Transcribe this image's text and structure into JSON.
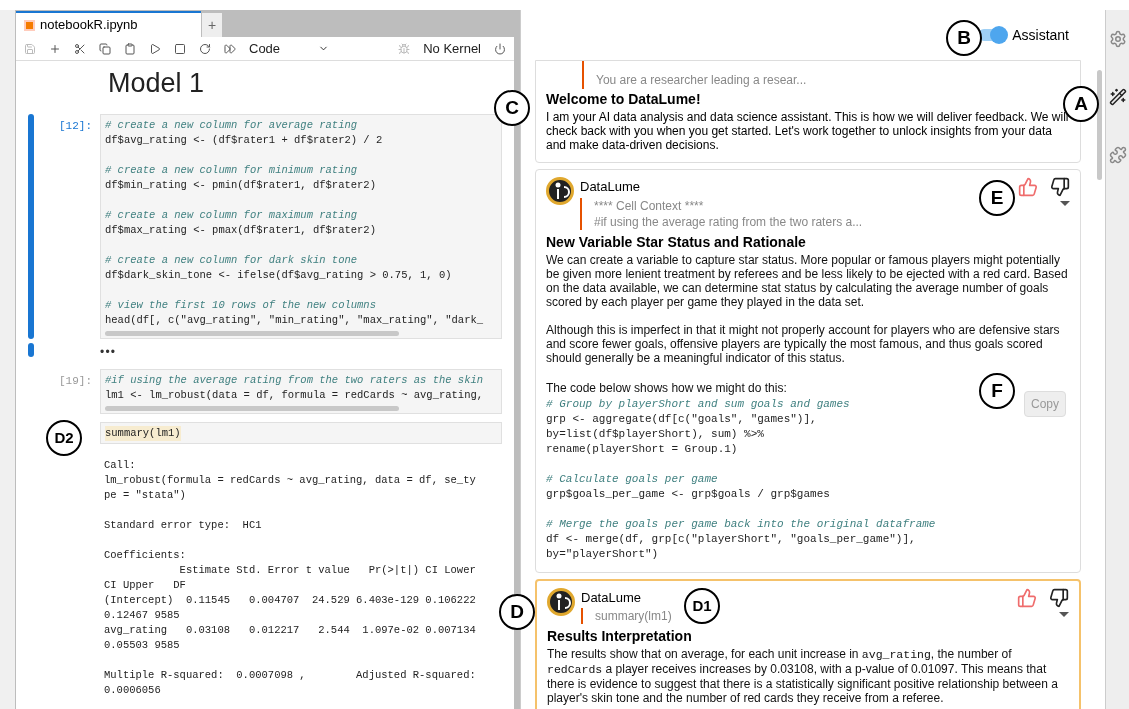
{
  "notebook": {
    "tab": {
      "title": "notebookR.ipynb",
      "selected": true
    },
    "new_tab": "+",
    "cell_type": "Code",
    "kernel": "No Kernel",
    "heading": "Model 1",
    "cells": [
      {
        "kind": "code",
        "prompt": "[12]:",
        "active": true,
        "lines": [
          {
            "kind": "comment",
            "text": "# create a new column for average rating"
          },
          {
            "kind": "code",
            "text": "df$avg_rating <- (df$rater1 + df$rater2) / 2"
          },
          {
            "kind": "blank"
          },
          {
            "kind": "comment",
            "text": "# create a new column for minimum rating"
          },
          {
            "kind": "code",
            "text": "df$min_rating <- pmin(df$rater1, df$rater2)"
          },
          {
            "kind": "blank"
          },
          {
            "kind": "comment",
            "text": "# create a new column for maximum rating"
          },
          {
            "kind": "code",
            "text": "df$max_rating <- pmax(df$rater1, df$rater2)"
          },
          {
            "kind": "blank"
          },
          {
            "kind": "comment",
            "text": "# create a new column for dark skin tone"
          },
          {
            "kind": "code",
            "text": "df$dark_skin_tone <- ifelse(df$avg_rating > 0.75, 1, 0)"
          },
          {
            "kind": "blank"
          },
          {
            "kind": "comment",
            "text": "# view the first 10 rows of the new columns"
          },
          {
            "kind": "code",
            "text": "head(df[, c(\"avg_rating\", \"min_rating\", \"max_rating\", \"dark_"
          }
        ]
      },
      {
        "kind": "collapsed",
        "active": true,
        "text": "•••"
      },
      {
        "kind": "code",
        "prompt": "[19]:",
        "active": false,
        "lines": [
          {
            "kind": "comment",
            "text": "#if using the average rating from the two raters as the skin"
          },
          {
            "kind": "code",
            "text": "lm1 <- lm_robust(data = df, formula = redCards ~ avg_rating,"
          }
        ]
      },
      {
        "kind": "highlight",
        "active": false,
        "lines": [
          {
            "kind": "code",
            "text": "summary(lm1)"
          }
        ]
      },
      {
        "kind": "output",
        "active": false,
        "lines": [
          {
            "kind": "code",
            "text": "Call:"
          },
          {
            "kind": "code",
            "text": "lm_robust(formula = redCards ~ avg_rating, data = df, se_ty"
          },
          {
            "kind": "code",
            "text": "pe = \"stata\")"
          },
          {
            "kind": "blank"
          },
          {
            "kind": "code",
            "text": "Standard error type:  HC1"
          },
          {
            "kind": "blank"
          },
          {
            "kind": "code",
            "text": "Coefficients:"
          },
          {
            "kind": "code",
            "text": "            Estimate Std. Error t value   Pr(>|t|) CI Lower"
          },
          {
            "kind": "code",
            "text": "CI Upper   DF"
          },
          {
            "kind": "code",
            "text": "(Intercept)  0.11545   0.004707  24.529 6.403e-129 0.106222"
          },
          {
            "kind": "code",
            "text": "0.12467 9585"
          },
          {
            "kind": "code",
            "text": "avg_rating   0.03108   0.012217   2.544  1.097e-02 0.007134"
          },
          {
            "kind": "code",
            "text": "0.05503 9585"
          },
          {
            "kind": "blank"
          },
          {
            "kind": "code",
            "text": "Multiple R-squared:  0.0007098 ,        Adjusted R-squared:"
          },
          {
            "kind": "code",
            "text": "0.0006056"
          }
        ]
      }
    ]
  },
  "assistant": {
    "toggle": {
      "label": "Assistant",
      "on": true
    },
    "welcome": {
      "context": "You are a researcher leading a resear...",
      "title": "Welcome to DataLume!",
      "body": "I am your AI data analysis and data science assistant. This is how we will deliver feedback. We will check back with you when you get started. Let's work together to unlock insights from your data and make data-driven decisions."
    },
    "messages": [
      {
        "sender": "DataLume",
        "highlighted": false,
        "context": [
          "**** Cell Context ****",
          "#if using the average rating from the two raters a..."
        ],
        "title": "New Variable Star Status and Rationale",
        "paragraphs": [
          [
            {
              "kind": "text",
              "text": "We can create a variable to capture star status. More popular or famous players might potentially be given more lenient treatment by referees and be less likely to be ejected with a red card. Based on the data available, we can determine stat status by calculating the average number of goals scored by each player per game they played in the data set."
            }
          ],
          [
            {
              "kind": "text",
              "text": "Although this is imperfect in that it might not properly account for players who are defensive stars and score fewer goals, offensive players are typically the most famous, and thus goals scored should generally be a meaningful indicator of this status."
            }
          ]
        ],
        "code_intro": "The code below shows how we might do this:",
        "copy": "Copy",
        "code": [
          {
            "kind": "comment",
            "text": "# Group by playerShort and sum goals and games"
          },
          {
            "kind": "code",
            "text": "grp <- aggregate(df[c(\"goals\", \"games\")],"
          },
          {
            "kind": "code",
            "text": "by=list(df$playerShort), sum) %>%"
          },
          {
            "kind": "code",
            "text": "rename(playerShort = Group.1)"
          },
          {
            "kind": "blank"
          },
          {
            "kind": "comment",
            "text": "# Calculate goals per game"
          },
          {
            "kind": "code",
            "text": "grp$goals_per_game <- grp$goals / grp$games"
          },
          {
            "kind": "blank"
          },
          {
            "kind": "comment",
            "text": "# Merge the goals per game back into the original dataframe"
          },
          {
            "kind": "code",
            "text": "df <- merge(df, grp[c(\"playerShort\", \"goals_per_game\")],"
          },
          {
            "kind": "code",
            "text": "by=\"playerShort\")"
          }
        ]
      },
      {
        "sender": "DataLume",
        "highlighted": true,
        "context": [
          "summary(lm1)"
        ],
        "title": "Results Interpretation",
        "paragraphs": [
          [
            {
              "kind": "text",
              "text": "The results show that on average, for each unit increase in "
            },
            {
              "kind": "code",
              "text": "avg_rating"
            },
            {
              "kind": "text",
              "text": ", the number of "
            },
            {
              "kind": "code",
              "text": "redCards"
            },
            {
              "kind": "text",
              "text": " a player receives increases by 0.03108, with a p-value of 0.01097. This means that there is evidence to suggest that there is a statistically significant positive relationship between a player's skin tone and the number of red cards they receive from a referee."
            }
          ]
        ]
      }
    ]
  },
  "callouts": [
    {
      "label": "A"
    },
    {
      "label": "B"
    },
    {
      "label": "C"
    },
    {
      "label": "D"
    },
    {
      "label": "D1"
    },
    {
      "label": "D2"
    },
    {
      "label": "E"
    },
    {
      "label": "F"
    }
  ]
}
